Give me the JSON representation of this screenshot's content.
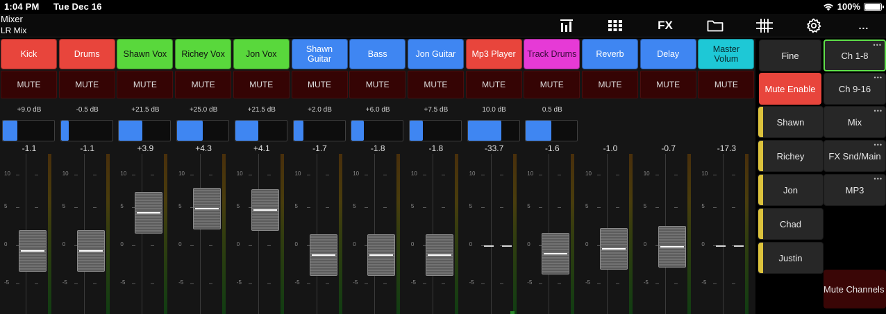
{
  "status_bar": {
    "time": "1:04 PM",
    "date": "Tue Dec 16",
    "battery": "100%",
    "wifi_icon": "wifi-icon",
    "battery_icon": "battery-icon"
  },
  "header": {
    "title": "Mixer",
    "subtitle": "LR Mix"
  },
  "toolbar": {
    "meters_icon": "meters-icon",
    "grid_icon": "grid-icon",
    "fx_label": "FX",
    "folder_icon": "folder-icon",
    "routing_icon": "routing-grid-icon",
    "gear_icon": "gear-icon",
    "more_label": "..."
  },
  "fader_scale": [
    "10",
    "5",
    "0",
    "-5"
  ],
  "colors": {
    "red": "#e8453c",
    "green": "#59d83c",
    "blue": "#3f86f2",
    "magenta": "#e63ad6",
    "cyan": "#1ec8d6",
    "mute_bg": "#350404",
    "yellow": "#dcc23c"
  },
  "channels": [
    {
      "name": "Kick",
      "color": "#e8453c",
      "text_color": "#ffffff",
      "mute": "MUTE",
      "gain": "+9.0 dB",
      "gain_fraction": 0.28,
      "level": "-1.1",
      "fader": true
    },
    {
      "name": "Drums",
      "color": "#e8453c",
      "text_color": "#ffffff",
      "mute": "MUTE",
      "gain": "-0.5 dB",
      "gain_fraction": 0.15,
      "level": "-1.1",
      "fader": true
    },
    {
      "name": "Shawn Vox",
      "color": "#59d83c",
      "text_color": "#111111",
      "mute": "MUTE",
      "gain": "+21.5 dB",
      "gain_fraction": 0.45,
      "level": "+3.9",
      "fader": true
    },
    {
      "name": "Richey Vox",
      "color": "#59d83c",
      "text_color": "#111111",
      "mute": "MUTE",
      "gain": "+25.0 dB",
      "gain_fraction": 0.5,
      "level": "+4.3",
      "fader": true
    },
    {
      "name": "Jon Vox",
      "color": "#59d83c",
      "text_color": "#111111",
      "mute": "MUTE",
      "gain": "+21.5 dB",
      "gain_fraction": 0.45,
      "level": "+4.1",
      "fader": true
    },
    {
      "name": "Shawn Guitar",
      "color": "#3f86f2",
      "text_color": "#ffffff",
      "mute": "MUTE",
      "gain": "+2.0 dB",
      "gain_fraction": 0.19,
      "level": "-1.7",
      "fader": true
    },
    {
      "name": "Bass",
      "color": "#3f86f2",
      "text_color": "#ffffff",
      "mute": "MUTE",
      "gain": "+6.0 dB",
      "gain_fraction": 0.24,
      "level": "-1.8",
      "fader": true
    },
    {
      "name": "Jon Guitar",
      "color": "#3f86f2",
      "text_color": "#ffffff",
      "mute": "MUTE",
      "gain": "+7.5 dB",
      "gain_fraction": 0.26,
      "level": "-1.8",
      "fader": true
    },
    {
      "name": "Mp3 Player",
      "color": "#e8453c",
      "text_color": "#ffffff",
      "mute": "MUTE",
      "gain": "10.0 dB",
      "gain_fraction": 0.66,
      "level": "-33.7",
      "fader": false
    },
    {
      "name": "Track Drums",
      "color": "#e63ad6",
      "text_color": "#3a0a3a",
      "mute": "MUTE",
      "gain": "0.5 dB",
      "gain_fraction": 0.5,
      "level": "-1.6",
      "fader": true
    },
    {
      "name": "Reverb",
      "color": "#3f86f2",
      "text_color": "#ffffff",
      "mute": "MUTE",
      "gain": "",
      "gain_fraction": null,
      "level": "-1.0",
      "fader": true
    },
    {
      "name": "Delay",
      "color": "#3f86f2",
      "text_color": "#ffffff",
      "mute": "MUTE",
      "gain": "",
      "gain_fraction": null,
      "level": "-0.7",
      "fader": true
    },
    {
      "name": "Master Volum",
      "color": "#1ec8d6",
      "text_color": "#0a2a2e",
      "mute": "MUTE",
      "gain": "",
      "gain_fraction": null,
      "level": "-17.3",
      "fader": false
    }
  ],
  "side_panel": {
    "fine": "Fine",
    "ch_1_8": "Ch 1-8",
    "mute_enable": "Mute Enable",
    "ch_9_16": "Ch 9-16",
    "mix": "Mix",
    "fx_snd_main": "FX Snd/Main",
    "mp3": "MP3",
    "mute_channels": "Mute Channels",
    "users": [
      "Shawn",
      "Richey",
      "Jon",
      "Chad",
      "Justin"
    ],
    "dots": "•••"
  }
}
